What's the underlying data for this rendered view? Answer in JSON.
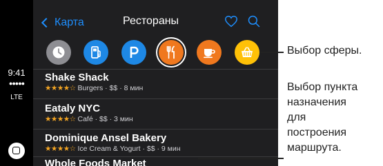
{
  "status": {
    "time": "9:41",
    "signal_dots": "●●●●●",
    "network": "LTE"
  },
  "navbar": {
    "back_label": "Карта",
    "title": "Рестораны"
  },
  "categories": [
    {
      "icon": "clock-icon",
      "color": "#8e8e93"
    },
    {
      "icon": "fuel-icon",
      "color": "#1e88e5"
    },
    {
      "icon": "parking-icon",
      "color": "#1e88e5"
    },
    {
      "icon": "fork-knife-icon",
      "color": "#f0781e",
      "selected": true
    },
    {
      "icon": "coffee-icon",
      "color": "#f0781e"
    },
    {
      "icon": "basket-icon",
      "color": "#ffc107"
    }
  ],
  "results": [
    {
      "name": "Shake Shack",
      "stars": "★★★★☆",
      "meta": " Burgers · $$ · 8 мин"
    },
    {
      "name": "Eataly NYC",
      "stars": "★★★★☆",
      "meta": " Café · $$ · 3 мин"
    },
    {
      "name": "Dominique Ansel Bakery",
      "stars": "★★★★☆",
      "meta": " Ice Cream & Yogurt · $$ · 9 мин"
    },
    {
      "name": "Whole Foods Market"
    }
  ],
  "annotations": {
    "category_callout": "Выбор сферы.",
    "destination_callout": "Выбор пункта\nназначения\nдля\nпостроения\nмаршрута."
  }
}
